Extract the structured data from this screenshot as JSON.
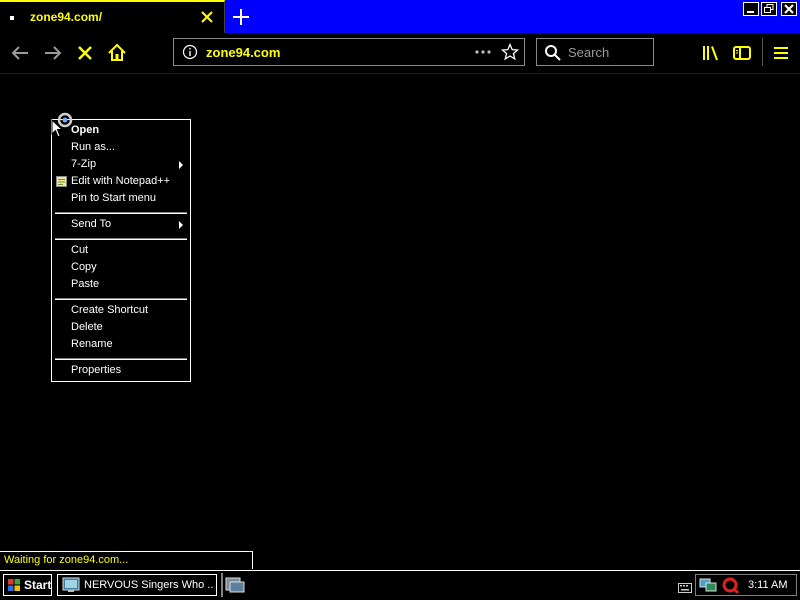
{
  "browser": {
    "tab": {
      "title": "zone94.com/"
    },
    "url": "zone94.com",
    "search_placeholder": "Search",
    "status": "Waiting for zone94.com..."
  },
  "context_menu": {
    "items": [
      {
        "label": "Open",
        "bold": true
      },
      {
        "label": "Run as..."
      },
      {
        "label": "7-Zip",
        "submenu": true
      },
      {
        "label": "Edit with Notepad++",
        "icon": "notepad-plus-icon"
      },
      {
        "label": "Pin to Start menu"
      },
      {
        "label": "Send To",
        "submenu": true
      },
      {
        "label": "Cut"
      },
      {
        "label": "Copy"
      },
      {
        "label": "Paste"
      },
      {
        "label": "Create Shortcut"
      },
      {
        "label": "Delete"
      },
      {
        "label": "Rename"
      },
      {
        "label": "Properties"
      }
    ]
  },
  "taskbar": {
    "start_label": "Start",
    "task_label": "NERVOUS Singers Who ...",
    "clock": "3:11 AM"
  },
  "colors": {
    "accent_text": "#FFFF00",
    "title_bar": "#0000FF",
    "background": "#000000",
    "foreground": "#FFFFFF"
  }
}
